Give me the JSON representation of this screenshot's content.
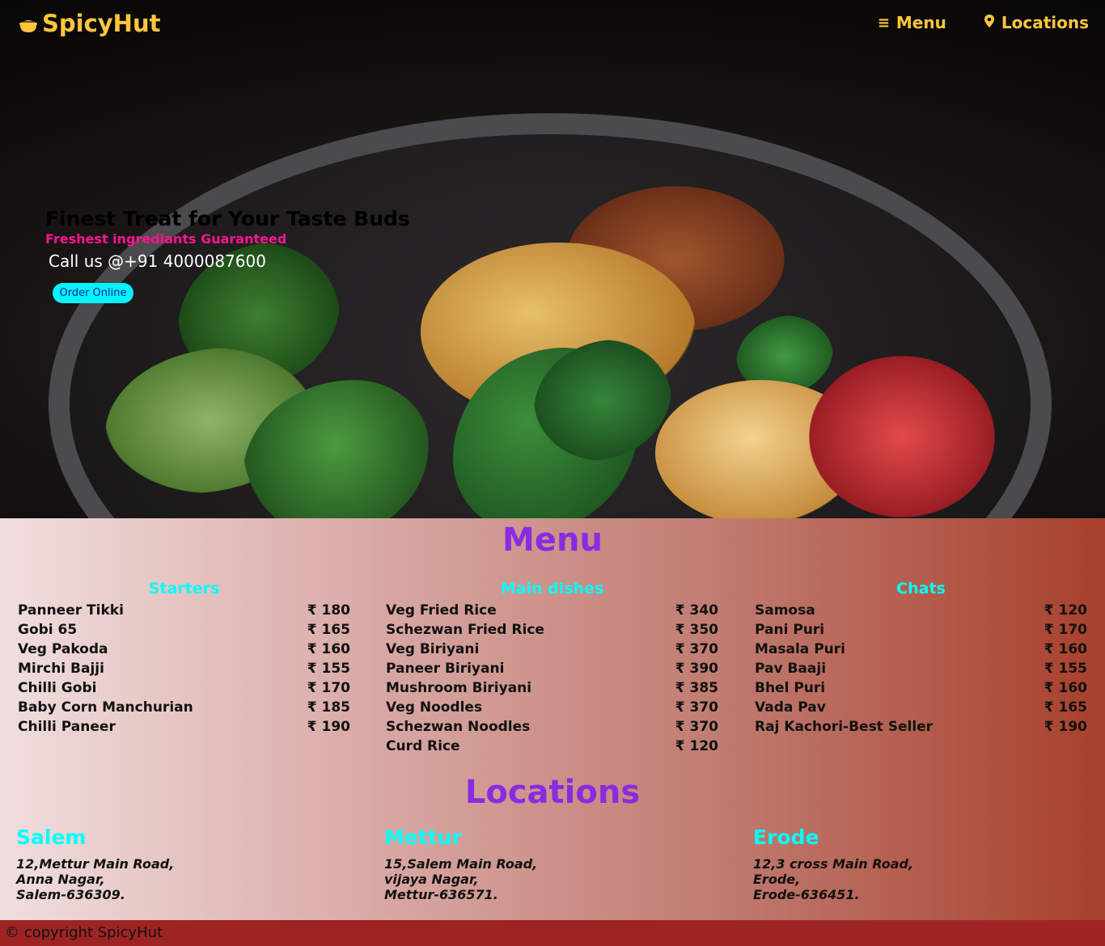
{
  "brand": {
    "name": "SpicyHut",
    "icon": "food-bowl-icon",
    "color": "#ffc53d"
  },
  "nav": {
    "menu_label": "Menu",
    "menu_icon": "hamburger-icon",
    "locations_label": "Locations",
    "locations_icon": "map-pin-icon"
  },
  "hero": {
    "title": "Finest Treat for Your Taste Buds",
    "subtitle": "Freshest ingrediants Guaranteed",
    "call": "Call us @+91 4000087600",
    "order_button": "Order Online"
  },
  "menu": {
    "title": "Menu",
    "columns": [
      {
        "title": "Starters",
        "items": [
          {
            "name": "Panneer Tikki",
            "price": "₹ 180"
          },
          {
            "name": "Gobi 65",
            "price": "₹ 165"
          },
          {
            "name": "Veg Pakoda",
            "price": "₹ 160"
          },
          {
            "name": "Mirchi Bajji",
            "price": "₹ 155"
          },
          {
            "name": "Chilli Gobi",
            "price": "₹ 170"
          },
          {
            "name": "Baby Corn Manchurian",
            "price": "₹ 185"
          },
          {
            "name": "Chilli Paneer",
            "price": "₹ 190"
          }
        ]
      },
      {
        "title": "Main dishes",
        "items": [
          {
            "name": "Veg Fried Rice",
            "price": "₹ 340"
          },
          {
            "name": "Schezwan Fried Rice",
            "price": "₹ 350"
          },
          {
            "name": "Veg Biriyani",
            "price": "₹ 370"
          },
          {
            "name": "Paneer Biriyani",
            "price": "₹ 390"
          },
          {
            "name": "Mushroom Biriyani",
            "price": "₹ 385"
          },
          {
            "name": "Veg Noodles",
            "price": "₹ 370"
          },
          {
            "name": "Schezwan Noodles",
            "price": "₹ 370"
          },
          {
            "name": "Curd Rice",
            "price": "₹ 120"
          }
        ]
      },
      {
        "title": "Chats",
        "items": [
          {
            "name": "Samosa",
            "price": "₹ 120"
          },
          {
            "name": "Pani Puri",
            "price": "₹ 170"
          },
          {
            "name": "Masala Puri",
            "price": "₹ 160"
          },
          {
            "name": "Pav Baaji",
            "price": "₹ 155"
          },
          {
            "name": "Bhel Puri",
            "price": "₹ 160"
          },
          {
            "name": "Vada Pav",
            "price": "₹ 165"
          },
          {
            "name": "Raj Kachori-Best Seller",
            "price": "₹ 190"
          }
        ]
      }
    ]
  },
  "locations": {
    "title": "Locations",
    "items": [
      {
        "city": "Salem",
        "lines": [
          "12,Mettur Main Road,",
          "Anna Nagar,",
          "Salem-636309."
        ]
      },
      {
        "city": "Mettur",
        "lines": [
          "15,Salem Main Road,",
          "vijaya Nagar,",
          "Mettur-636571."
        ]
      },
      {
        "city": "Erode",
        "lines": [
          "12,3 cross Main Road,",
          "Erode,",
          "Erode-636451."
        ]
      }
    ]
  },
  "footer": {
    "text": "© copyright SpicyHut"
  },
  "colors": {
    "accent": "#ffc53d",
    "heading": "#8a2be2",
    "subheading": "#00ffff",
    "button": "#00f5ff",
    "footer": "#9e2424",
    "tagline": "#ff1493"
  }
}
